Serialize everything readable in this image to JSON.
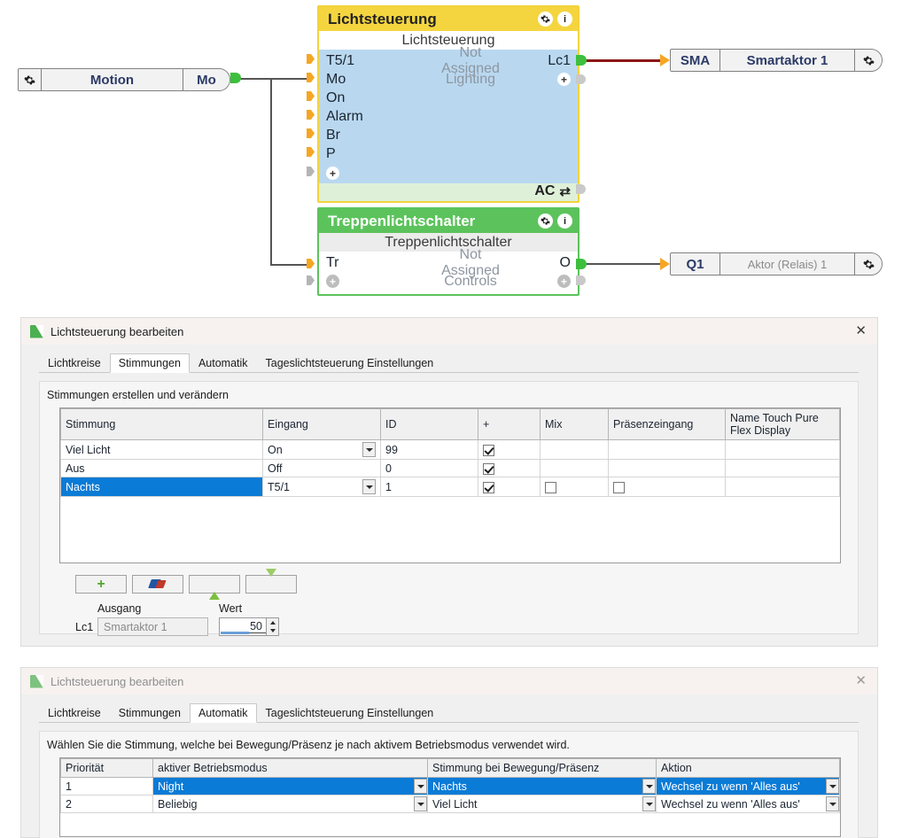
{
  "canvas": {
    "motion_node": {
      "gear_icon": "gear-icon",
      "name": "Motion",
      "port": "Mo"
    },
    "light_node": {
      "header_title": "Lichtsteuerung",
      "gear_icon": "gear-icon",
      "info_icon": "info-icon",
      "subtitle": "Lichtsteuerung",
      "inputs": [
        "T5/1",
        "Mo",
        "On",
        "Alarm",
        "Br",
        "P"
      ],
      "add_input_label": "+",
      "center_line_1": "Not Assigned",
      "center_line_2": "Lighting",
      "output_1": "Lc1",
      "output_add": "+",
      "footer_label": "AC",
      "footer_icon": "swap-icon"
    },
    "stair_node": {
      "header_title": "Treppenlichtschalter",
      "gear_icon": "gear-icon",
      "info_icon": "info-icon",
      "subtitle": "Treppenlichtschalter",
      "input_1": "Tr",
      "input_add": "+",
      "center_line_1": "Not Assigned",
      "center_line_2": "Controls",
      "output_1": "O",
      "output_add": "+"
    },
    "sma_node": {
      "port": "SMA",
      "name": "Smartaktor 1",
      "gear_icon": "gear-icon"
    },
    "q1_node": {
      "port": "Q1",
      "name": "Aktor (Relais) 1",
      "gear_icon": "gear-icon"
    },
    "colors": {
      "light_node_header": "#f4d53f",
      "light_node_body": "#b9d8f0",
      "stair_node_header": "#5cc35c",
      "wire": "#555555",
      "wire_red": "#8c1616",
      "port_green": "#3dbf3d",
      "port_orange": "#f5a623"
    }
  },
  "dialog1": {
    "title": "Lichtsteuerung bearbeiten",
    "close_label": "✕",
    "tabs": [
      {
        "label": "Lichtkreise",
        "active": false
      },
      {
        "label": "Stimmungen",
        "active": true
      },
      {
        "label": "Automatik",
        "active": false
      },
      {
        "label": "Tageslichtsteuerung Einstellungen",
        "active": false
      }
    ],
    "hint": "Stimmungen erstellen und verändern",
    "table": {
      "headers": [
        "Stimmung",
        "Eingang",
        "ID",
        "+",
        "Mix",
        "Präsenzeingang",
        "Name Touch Pure Flex Display"
      ],
      "rows": [
        {
          "selected": false,
          "stimmung": "Viel Licht",
          "eingang": "On",
          "eingang_combo": true,
          "id": "99",
          "plus_checked": true,
          "mix_visible": false,
          "praesenz_visible": false,
          "name_tp": ""
        },
        {
          "selected": false,
          "stimmung": "Aus",
          "eingang": "Off",
          "eingang_combo": false,
          "id": "0",
          "plus_checked": true,
          "mix_visible": false,
          "praesenz_visible": false,
          "name_tp": ""
        },
        {
          "selected": true,
          "stimmung": "Nachts",
          "eingang": "T5/1",
          "eingang_combo": true,
          "id": "1",
          "plus_checked": true,
          "mix_visible": true,
          "mix_checked": false,
          "praesenz_visible": true,
          "praesenz_checked": false,
          "name_tp": ""
        }
      ]
    },
    "toolbar": [
      {
        "name": "add-button",
        "icon": "plus-icon"
      },
      {
        "name": "delete-button",
        "icon": "eraser-icon"
      },
      {
        "name": "move-up-button",
        "icon": "arrow-up-icon"
      },
      {
        "name": "move-down-button",
        "icon": "arrow-down-icon"
      }
    ],
    "output_section": {
      "col_ausgang": "Ausgang",
      "col_wert": "Wert",
      "row_label": "Lc1",
      "ausgang_value": "Smartaktor 1",
      "wert_value": "50"
    }
  },
  "dialog2": {
    "title": "Lichtsteuerung bearbeiten",
    "close_label": "✕",
    "tabs": [
      {
        "label": "Lichtkreise",
        "active": false
      },
      {
        "label": "Stimmungen",
        "active": false
      },
      {
        "label": "Automatik",
        "active": true
      },
      {
        "label": "Tageslichtsteuerung Einstellungen",
        "active": false
      }
    ],
    "hint": "Wählen Sie die Stimmung, welche bei Bewegung/Präsenz je nach aktivem Betriebsmodus verwendet wird.",
    "table": {
      "headers": [
        "Priorität",
        "aktiver Betriebsmodus",
        "Stimmung bei Bewegung/Präsenz",
        "Aktion"
      ],
      "rows": [
        {
          "selected": true,
          "prio": "1",
          "modus": "Night",
          "stimmung": "Nachts",
          "aktion": "Wechsel zu wenn 'Alles aus'"
        },
        {
          "selected": false,
          "prio": "2",
          "modus": "Beliebig",
          "stimmung": "Viel Licht",
          "aktion": "Wechsel zu wenn 'Alles aus'"
        }
      ]
    }
  }
}
